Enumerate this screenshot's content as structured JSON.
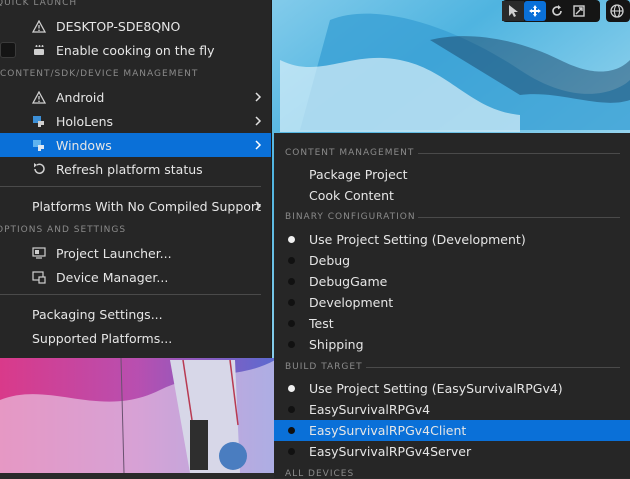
{
  "quick_launch": {
    "header": "QUICK LAUNCH",
    "device": "DESKTOP-SDE8QNO",
    "cook_toggle": "Enable cooking on the fly"
  },
  "csd": {
    "header": "CONTENT/SDK/DEVICE MANAGEMENT",
    "android": "Android",
    "hololens": "HoloLens",
    "windows": "Windows",
    "refresh": "Refresh platform status",
    "no_compiled": "Platforms With No Compiled Support"
  },
  "options": {
    "header": "OPTIONS AND SETTINGS",
    "launcher": "Project Launcher...",
    "device_manager": "Device Manager...",
    "packaging": "Packaging Settings...",
    "supported": "Supported Platforms..."
  },
  "submenu": {
    "content_header": "CONTENT MANAGEMENT",
    "package": "Package Project",
    "cook": "Cook Content",
    "binary_header": "BINARY CONFIGURATION",
    "configs": [
      {
        "label": "Use Project Setting (Development)",
        "selected": true
      },
      {
        "label": "Debug",
        "selected": false
      },
      {
        "label": "DebugGame",
        "selected": false
      },
      {
        "label": "Development",
        "selected": false
      },
      {
        "label": "Test",
        "selected": false
      },
      {
        "label": "Shipping",
        "selected": false
      }
    ],
    "build_header": "BUILD TARGET",
    "targets": [
      {
        "label": "Use Project Setting (EasySurvivalRPGv4)",
        "selected": true
      },
      {
        "label": "EasySurvivalRPGv4",
        "selected": false
      },
      {
        "label": "EasySurvivalRPGv4Client",
        "selected": false
      },
      {
        "label": "EasySurvivalRPGv4Server",
        "selected": false
      }
    ],
    "all_devices_header": "ALL DEVICES"
  },
  "icons": {
    "warning": "warning-icon",
    "cook": "cook-icon",
    "hololens": "hololens-icon",
    "windows": "windows-icon",
    "refresh": "refresh-icon",
    "launcher": "project-launcher-icon",
    "device_manager": "device-manager-icon",
    "toolbar": [
      "select-icon",
      "translate-icon",
      "rotate-icon",
      "scale-icon",
      "world-icon"
    ]
  },
  "colors": {
    "accent": "#0a70d8",
    "menu_bg": "#262626",
    "text": "#e6e6e6",
    "header": "#8a8a8a"
  }
}
